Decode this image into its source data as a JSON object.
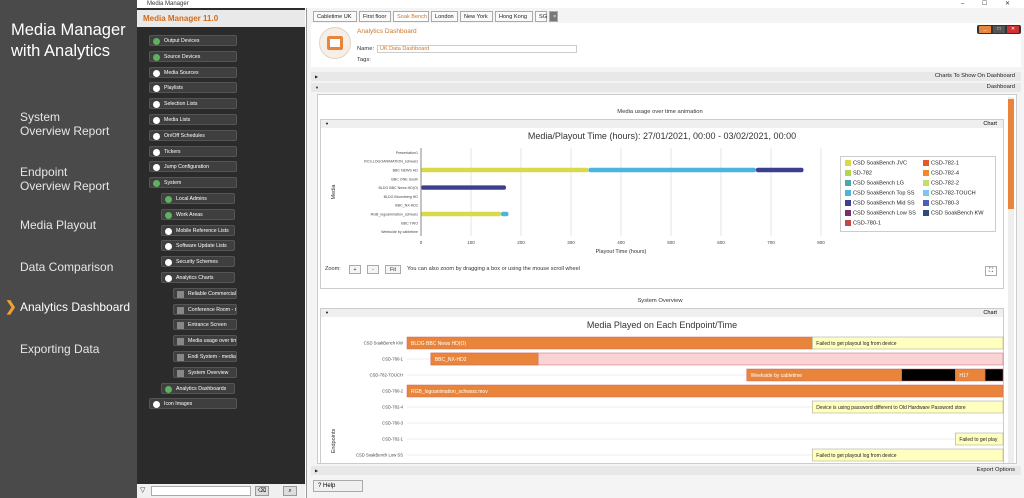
{
  "left_panel": {
    "title_line1": "Media Manager",
    "title_line2": "with Analytics",
    "nav": [
      {
        "l1": "System",
        "l2": "Overview Report"
      },
      {
        "l1": "Endpoint",
        "l2": "Overview Report"
      },
      {
        "l1": "Media Playout",
        "l2": ""
      },
      {
        "l1": "Data Comparison",
        "l2": ""
      },
      {
        "l1": "Analytics Dashboard",
        "l2": "",
        "active": true
      },
      {
        "l1": "Exporting Data",
        "l2": ""
      }
    ]
  },
  "window": {
    "title": "Media Manager",
    "controls": "‒ ☐ ✕"
  },
  "tree": {
    "header": "Media Manager 11.0",
    "items": [
      "Output Devices",
      "Source Devices",
      "Media Sources",
      "Playlists",
      "Selection Lists",
      "Media Lists",
      "On/Off Schedules",
      "Tickers",
      "Jump Configuration",
      "System",
      "Local Admins",
      "Work Areas",
      "Mobile Reference Lists",
      "Software Update Lists",
      "Security Schemes",
      "Analytics Charts",
      "Reliable Commercials f...",
      "Conference Room - m...",
      "Entrance Screen",
      "Media usage over time...",
      "Endi System - media ...",
      "System Overview",
      "Analytics Dashboards",
      "Icon Images"
    ],
    "filter_icon": "funnel-icon"
  },
  "tabs": [
    "Cabletime UK",
    "First floor",
    "Soak Bench",
    "London",
    "New York",
    "Hong Kong",
    "SG",
    "×"
  ],
  "header": {
    "title": "Analytics Dashboard",
    "name_label": "Name:",
    "name_value": "UK Data Dashboard",
    "tags_label": "Tags:",
    "win_btns": [
      "_",
      "□",
      "✕"
    ]
  },
  "sections": {
    "charts_show": "Charts To Show On Dashboard",
    "dashboard": "Dashboard",
    "export": "Export Options",
    "help": "Help"
  },
  "panel1": {
    "title": "Media usage over time animation",
    "bar": "Chart",
    "zoom_label": "Zoom:",
    "zoom_plus": "+",
    "zoom_minus": "-",
    "fit": "Fit",
    "zoom_hint": "You can also zoom by dragging a box or using the mouse scroll wheel"
  },
  "panel2": {
    "title": "System Overview",
    "bar": "Chart"
  },
  "chart_data": [
    {
      "type": "bar",
      "title": "Media/Playout Time (hours): 27/01/2021, 00:00 - 03/02/2021, 00:00",
      "xlabel": "Playout Time (hours)",
      "ylabel": "Media",
      "xlim": [
        0,
        800
      ],
      "xticks": [
        0,
        100,
        200,
        300,
        400,
        500,
        600,
        700,
        800
      ],
      "categories": [
        "Presentation1",
        "RCS,LOGOANIMATION_schwarz",
        "BBC NEWS HD",
        "BBC ONE South",
        "BLDG BBC News HD(O)",
        "BLDG Bloomberg HD",
        "BBC_NX-HD2",
        "RGB_logoanimation_schwarz",
        "BBC TWO",
        "Weekside by cabletime"
      ],
      "series": [
        {
          "name": "CSD SoakBench JVC",
          "color": "#d9d94a",
          "values": [
            0,
            0,
            335,
            0,
            0,
            0,
            0,
            160,
            0,
            0
          ]
        },
        {
          "name": "CSD-782-1",
          "color": "#e05a2a",
          "values": [
            0,
            0,
            0,
            0,
            0,
            0,
            0,
            0,
            0,
            0
          ]
        },
        {
          "name": "SD-782",
          "color": "#b5d552",
          "values": [
            0,
            0,
            0,
            0,
            0,
            0,
            0,
            0,
            0,
            0
          ]
        },
        {
          "name": "CSD-782-4",
          "color": "#f08a2a",
          "values": [
            0,
            0,
            0,
            0,
            0,
            0,
            0,
            0,
            0,
            0
          ]
        },
        {
          "name": "CSD SoakBench LG",
          "color": "#4aa8a8",
          "values": [
            0,
            0,
            0,
            0,
            0,
            0,
            0,
            0,
            0,
            0
          ]
        },
        {
          "name": "CSD-782-2",
          "color": "#c7dd6a",
          "values": [
            0,
            0,
            0,
            0,
            0,
            0,
            0,
            0,
            0,
            0
          ]
        },
        {
          "name": "CSD SoakBench Top SS",
          "color": "#4db3e0",
          "values": [
            0,
            0,
            335,
            0,
            0,
            0,
            0,
            15,
            0,
            0
          ]
        },
        {
          "name": "CSD-782-TOUCH",
          "color": "#7fc7e8",
          "values": [
            0,
            0,
            0,
            0,
            0,
            0,
            0,
            0,
            0,
            0
          ]
        },
        {
          "name": "CSD SoakBench Mid SS",
          "color": "#3b3f8f",
          "values": [
            0,
            0,
            95,
            0,
            170,
            0,
            0,
            0,
            0,
            0
          ]
        },
        {
          "name": "CSD-780-3",
          "color": "#4a5fb5",
          "values": [
            0,
            0,
            0,
            0,
            0,
            0,
            0,
            0,
            0,
            0
          ]
        },
        {
          "name": "CSD SoakBench Low SS",
          "color": "#7a2f6a",
          "values": [
            0,
            0,
            0,
            0,
            0,
            0,
            0,
            0,
            0,
            0
          ]
        },
        {
          "name": "CSD SoakBench KW",
          "color": "#2c4a7a",
          "values": [
            0,
            0,
            0,
            0,
            0,
            0,
            0,
            0,
            0,
            0
          ]
        },
        {
          "name": "CSD-780-1",
          "color": "#c0484a",
          "values": [
            0,
            0,
            0,
            0,
            0,
            0,
            0,
            0,
            0,
            0
          ]
        }
      ],
      "legend": "right"
    },
    {
      "type": "table",
      "title": "Media Played on Each Endpoint/Time",
      "ylabel": "Endpoints",
      "categories": [
        "CSD SoakBench KW",
        "CSD-780-1",
        "CSD-782-TOUCH",
        "CSD-780-2",
        "CSD-782-4",
        "CSD-780-3",
        "CSD-782-1",
        "CSD SoakBench Low SS"
      ],
      "rows": [
        {
          "segments": [
            {
              "label": "BLDG BBC News HD(O)",
              "color": "#e9853a",
              "start": 0,
              "end": 0.68
            },
            {
              "label": "Failed to get playout log from device",
              "color": "#ffffc0",
              "start": 0.68,
              "end": 1.0
            }
          ]
        },
        {
          "segments": [
            {
              "label": "",
              "color": "#fad4d4",
              "start": 0.04,
              "end": 1.0
            },
            {
              "label": "BBC_NX-HD2",
              "color": "#e9853a",
              "start": 0.04,
              "end": 0.22
            }
          ]
        },
        {
          "segments": [
            {
              "label": "Weekside by cabletime",
              "color": "#e9853a",
              "start": 0.57,
              "end": 0.83
            },
            {
              "label": "",
              "color": "#000000",
              "start": 0.83,
              "end": 0.92
            },
            {
              "label": "H17",
              "color": "#e9853a",
              "start": 0.92,
              "end": 0.97
            },
            {
              "label": "",
              "color": "#000000",
              "start": 0.97,
              "end": 1.0
            }
          ]
        },
        {
          "segments": [
            {
              "label": "RGB_logoanimation_schwarz.mov",
              "color": "#e9853a",
              "start": 0,
              "end": 1.0
            }
          ]
        },
        {
          "segments": [
            {
              "label": "Device is using password different to Old Hardware Password store",
              "color": "#ffffc0",
              "start": 0.68,
              "end": 1.0
            }
          ]
        },
        {
          "segments": []
        },
        {
          "segments": [
            {
              "label": "Failed to get play",
              "color": "#ffffc0",
              "start": 0.92,
              "end": 1.0
            }
          ]
        },
        {
          "segments": [
            {
              "label": "Failed to get playout log from device",
              "color": "#ffffc0",
              "start": 0.68,
              "end": 1.0
            }
          ]
        }
      ]
    }
  ]
}
